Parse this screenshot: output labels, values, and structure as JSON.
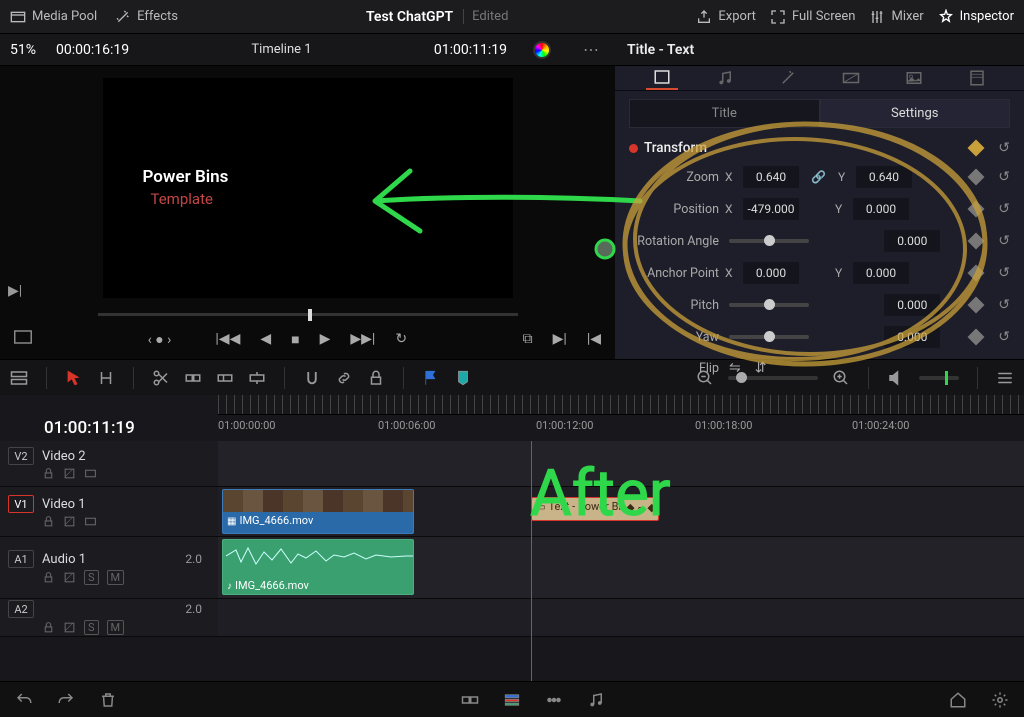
{
  "toolbar": {
    "media_pool": "Media Pool",
    "effects": "Effects",
    "project_title": "Test ChatGPT",
    "project_status": "Edited",
    "export": "Export",
    "fullscreen": "Full Screen",
    "mixer": "Mixer",
    "inspector": "Inspector"
  },
  "timecode_bar": {
    "zoom_percent": "51%",
    "source_tc": "00:00:16:19",
    "timeline_name": "Timeline 1",
    "record_tc": "01:00:11:19"
  },
  "inspector": {
    "panel_title": "Title - Text",
    "subtabs": {
      "title": "Title",
      "settings": "Settings"
    },
    "section_transform": "Transform",
    "rows": {
      "zoom": {
        "label": "Zoom",
        "x_label": "X",
        "x_val": "0.640",
        "y_label": "Y",
        "y_val": "0.640"
      },
      "position": {
        "label": "Position",
        "x_label": "X",
        "x_val": "-479.000",
        "y_label": "Y",
        "y_val": "0.000"
      },
      "rotation": {
        "label": "Rotation Angle",
        "val": "0.000"
      },
      "anchor": {
        "label": "Anchor Point",
        "x_label": "X",
        "x_val": "0.000",
        "y_label": "Y",
        "y_val": "0.000"
      },
      "pitch": {
        "label": "Pitch",
        "val": "0.000"
      },
      "yaw": {
        "label": "Yaw",
        "val": "0.000"
      },
      "flip": {
        "label": "Flip"
      }
    }
  },
  "viewer": {
    "line1": "Power Bins",
    "line2": "Template"
  },
  "timeline": {
    "current_tc": "01:00:11:19",
    "ruler_labels": [
      "01:00:00:00",
      "01:00:06:00",
      "01:00:12:00",
      "01:00:18:00",
      "01:00:24:00"
    ],
    "tracks": {
      "v2": {
        "badge": "V2",
        "name": "Video 2"
      },
      "v1": {
        "badge": "V1",
        "name": "Video 1"
      },
      "a1": {
        "badge": "A1",
        "name": "Audio 1",
        "level": "2.0"
      },
      "a2": {
        "badge": "A2",
        "name": "",
        "level": "2.0"
      }
    },
    "clips": {
      "video1": "IMG_4666.mov",
      "title1": "Text - Power Bi...",
      "audio1": "IMG_4666.mov"
    }
  },
  "annotation": {
    "after_text": "After"
  }
}
